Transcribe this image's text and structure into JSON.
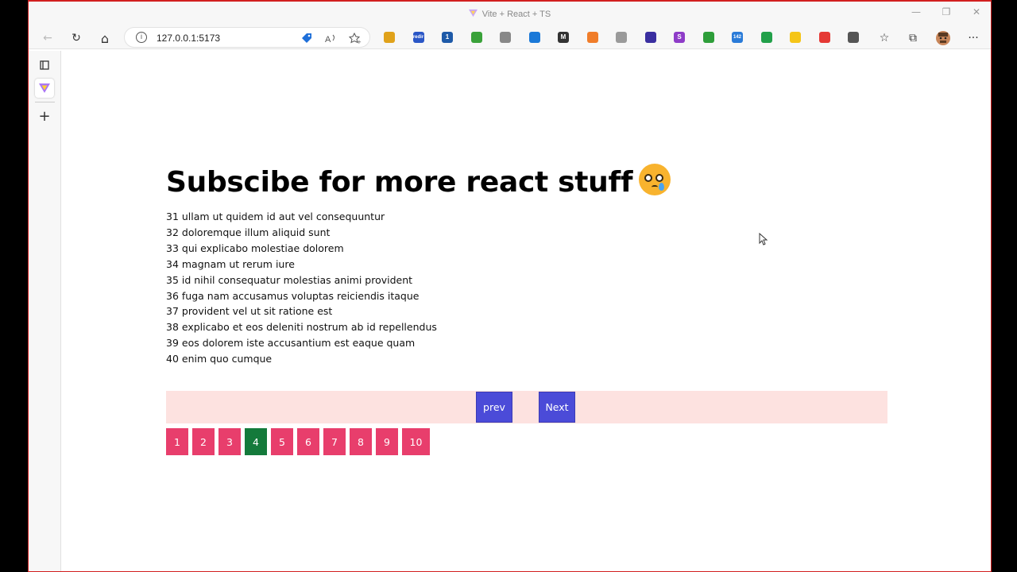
{
  "window": {
    "title": "Vite + React + TS",
    "minimize": "—",
    "restore": "❐",
    "close": "✕"
  },
  "toolbar": {
    "url": "127.0.0.1:5173",
    "back": "←",
    "reload": "↻",
    "home": "⌂",
    "favorites": "☆",
    "collections": "⧉",
    "more": "···",
    "extensions": [
      {
        "name": "sunflower-extension-icon",
        "color": "#e0a21b",
        "label": ""
      },
      {
        "name": "redirect-extension-icon",
        "color": "#2a56c6",
        "label": "redir"
      },
      {
        "name": "counter-extension-icon",
        "color": "#1e5aa8",
        "label": "1"
      },
      {
        "name": "shield-extension-icon",
        "color": "#3aa23a",
        "label": ""
      },
      {
        "name": "cube-extension-icon",
        "color": "#888888",
        "label": ""
      },
      {
        "name": "circle-blue-extension-icon",
        "color": "#1b79d8",
        "label": ""
      },
      {
        "name": "m-extension-icon",
        "color": "#333333",
        "label": "M"
      },
      {
        "name": "orange-extension-icon",
        "color": "#f07d2a",
        "label": ""
      },
      {
        "name": "grey-extension-icon",
        "color": "#9a9a9a",
        "label": ""
      },
      {
        "name": "indigo-extension-icon",
        "color": "#3a2fa0",
        "label": ""
      },
      {
        "name": "s-extension-icon",
        "color": "#8e3cc8",
        "label": "S"
      },
      {
        "name": "frog-extension-icon",
        "color": "#2e9e3a",
        "label": ""
      },
      {
        "name": "badge-142-extension-icon",
        "color": "#2a7bd8",
        "label": "142"
      },
      {
        "name": "green-dollar-extension-icon",
        "color": "#22a04a",
        "label": ""
      },
      {
        "name": "yellow-extension-icon",
        "color": "#f5c518",
        "label": ""
      },
      {
        "name": "play-extension-icon",
        "color": "#e53935",
        "label": ""
      },
      {
        "name": "puzzle-extension-icon",
        "color": "#555555",
        "label": ""
      }
    ]
  },
  "page": {
    "heading": "Subscibe for more react stuff",
    "items": [
      "31 ullam ut quidem id aut vel consequuntur",
      "32 doloremque illum aliquid sunt",
      "33 qui explicabo molestiae dolorem",
      "34 magnam ut rerum iure",
      "35 id nihil consequatur molestias animi provident",
      "36 fuga nam accusamus voluptas reiciendis itaque",
      "37 provident vel ut sit ratione est",
      "38 explicabo et eos deleniti nostrum ab id repellendus",
      "39 eos dolorem iste accusantium est eaque quam",
      "40 enim quo cumque"
    ],
    "prev_label": "prev",
    "next_label": "Next",
    "pages": [
      "1",
      "2",
      "3",
      "4",
      "5",
      "6",
      "7",
      "8",
      "9",
      "10"
    ],
    "active_page": "4"
  },
  "colors": {
    "nav_bg": "#fde2e0",
    "nav_button": "#4b4bd8",
    "page_button": "#e83e6c",
    "page_active": "#147a3b"
  }
}
